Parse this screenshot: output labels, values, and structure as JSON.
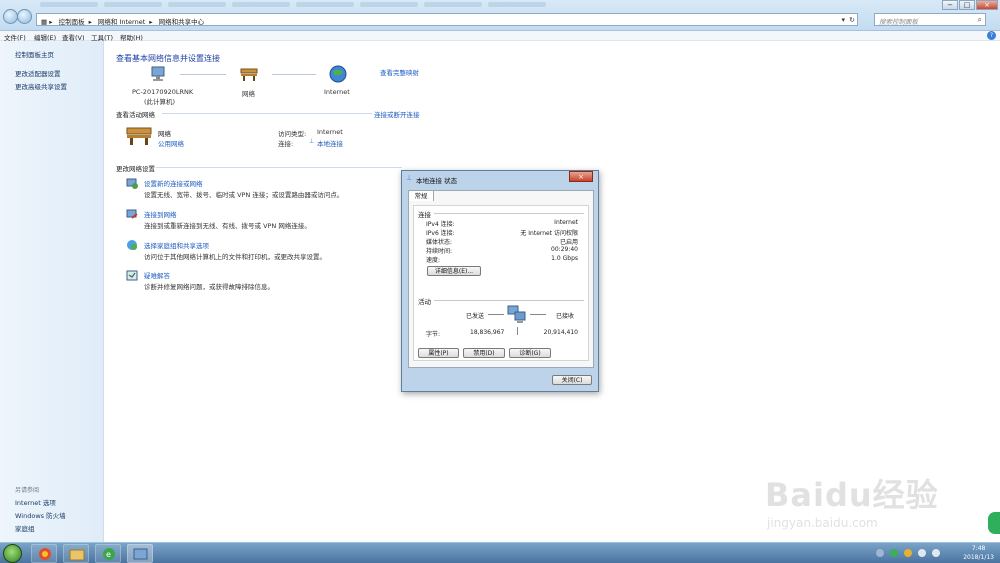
{
  "window": {
    "breadcrumb": [
      "控制面板",
      "网络和 Internet",
      "网络和共享中心"
    ],
    "search_placeholder": "搜索控制面板",
    "controls": [
      "−",
      "□",
      "×"
    ]
  },
  "menu": [
    "文件(F)",
    "编辑(E)",
    "查看(V)",
    "工具(T)",
    "帮助(H)"
  ],
  "sidebar": {
    "top_links": [
      "控制面板主页",
      "更改适配器设置",
      "更改高级共享设置"
    ],
    "see_also_label": "另请参阅",
    "bottom_links": [
      "Internet 选项",
      "Windows 防火墙",
      "家庭组"
    ]
  },
  "main": {
    "title": "查看基本网络信息并设置连接",
    "full_map_link": "查看完整映射",
    "map": {
      "pc_name": "PC-20170920LRNK",
      "pc_sub": "(此计算机)",
      "network": "网络",
      "internet": "Internet"
    },
    "active_header": "查看活动网络",
    "connect_disconnect": "连接或断开连接",
    "active": {
      "name": "网络",
      "type": "公用网络",
      "access_type_label": "访问类型:",
      "access_type_value": "Internet",
      "connections_label": "连接:",
      "connections_value": "本地连接"
    },
    "change_header": "更改网络设置",
    "tasks": [
      {
        "title": "设置新的连接或网络",
        "desc": "设置无线、宽带、拨号、临时或 VPN 连接；或设置路由器或访问点。"
      },
      {
        "title": "连接到网络",
        "desc": "连接到或重新连接到无线、有线、拨号或 VPN 网络连接。"
      },
      {
        "title": "选择家庭组和共享选项",
        "desc": "访问位于其他网络计算机上的文件和打印机，或更改共享设置。"
      },
      {
        "title": "疑难解答",
        "desc": "诊断并修复网络问题，或获得故障排除信息。"
      }
    ]
  },
  "dialog": {
    "title": "本地连接 状态",
    "tab": "常规",
    "connection_group": "连接",
    "rows": [
      {
        "k": "IPv4 连接:",
        "v": "Internet"
      },
      {
        "k": "IPv6 连接:",
        "v": "无 Internet 访问权限"
      },
      {
        "k": "媒体状态:",
        "v": "已启用"
      },
      {
        "k": "持续时间:",
        "v": "00:29:40"
      },
      {
        "k": "速度:",
        "v": "1.0 Gbps"
      }
    ],
    "details_button": "详细信息(E)...",
    "activity_group": "活动",
    "sent_label": "已发送",
    "received_label": "已接收",
    "bytes_label": "字节:",
    "bytes_sent": "18,836,967",
    "bytes_received": "20,914,410",
    "properties_button": "属性(P)",
    "disable_button": "禁用(D)",
    "diagnose_button": "诊断(G)",
    "close_button": "关闭(C)"
  },
  "taskbar": {
    "time": "7:48",
    "date": "2018/1/13"
  },
  "watermark": {
    "big": "Baidu经验",
    "small": "jingyan.baidu.com"
  },
  "colors": {
    "link": "#1a5bbf",
    "title": "#1f3fa3",
    "sidebar_bg": "#e6f0fa",
    "taskbar": "#4a74a0"
  }
}
